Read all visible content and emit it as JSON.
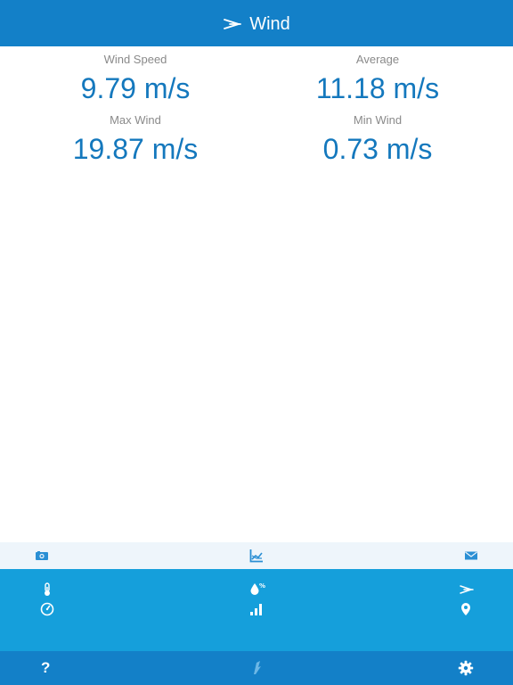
{
  "header": {
    "title": "Wind",
    "icon": "wind-icon"
  },
  "stats": [
    {
      "label": "Wind Speed",
      "value": "9.79 m/s"
    },
    {
      "label": "Average",
      "value": "11.18 m/s"
    },
    {
      "label": "Max Wind",
      "value": "19.87 m/s"
    },
    {
      "label": "Min Wind",
      "value": "0.73 m/s"
    }
  ],
  "action_strip": {
    "icons": [
      "camera-icon",
      "chart-icon",
      "mail-icon"
    ]
  },
  "nav_grid": {
    "icons": [
      "thermometer-icon",
      "humidity-icon",
      "wind-icon",
      "pressure-gauge-icon",
      "signal-bars-icon",
      "location-pin-icon"
    ]
  },
  "bottom_bar": {
    "help_label": "?",
    "icons": [
      "help-icon",
      "vane-icon",
      "settings-icon"
    ]
  },
  "colors": {
    "header_bg": "#1380c8",
    "value_text": "#1478bd",
    "label_text": "#8a8a8a",
    "strip_bg": "#eef5fb",
    "nav_bg": "#159fdb",
    "icon_color": "#ffffff"
  }
}
